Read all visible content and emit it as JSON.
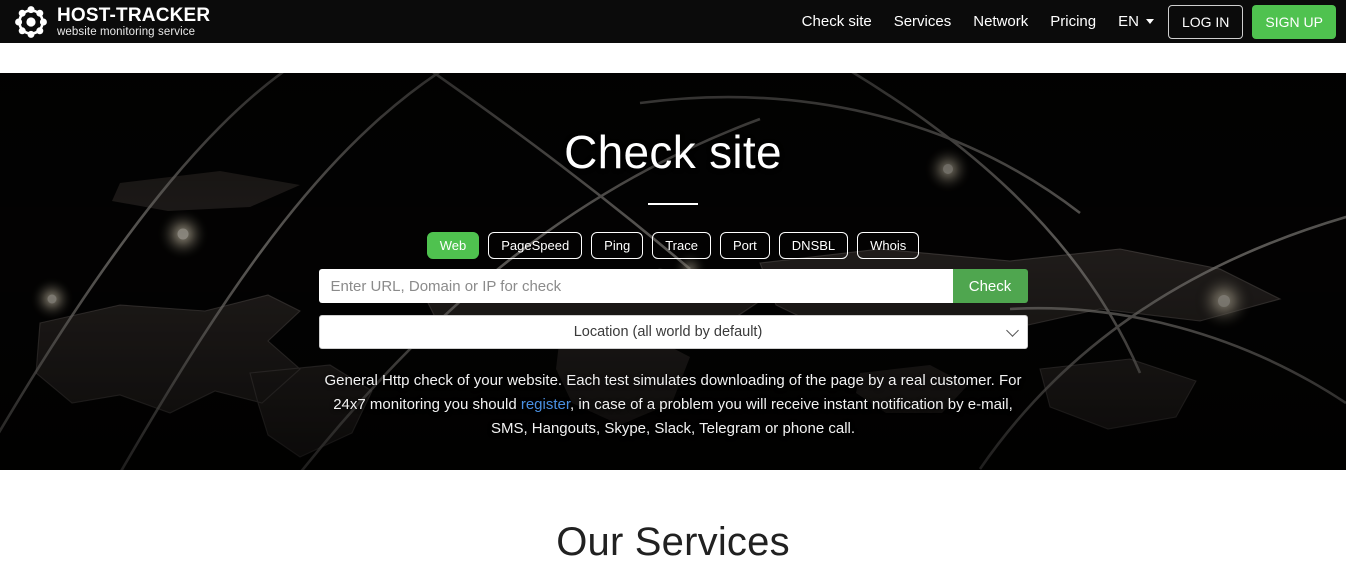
{
  "header": {
    "logo_icon": "atom-ring-icon",
    "brand_name": "HOST-TRACKER",
    "brand_sub": "website monitoring service",
    "nav": [
      {
        "label": "Check site",
        "name": "nav-check-site"
      },
      {
        "label": "Services",
        "name": "nav-services"
      },
      {
        "label": "Network",
        "name": "nav-network"
      },
      {
        "label": "Pricing",
        "name": "nav-pricing"
      }
    ],
    "language": "EN",
    "language_caret_icon": "caret-down-icon",
    "login_label": "LOG IN",
    "signup_label": "SIGN UP"
  },
  "hero": {
    "title": "Check site",
    "tabs": [
      {
        "label": "Web",
        "active": true
      },
      {
        "label": "PageSpeed",
        "active": false
      },
      {
        "label": "Ping",
        "active": false
      },
      {
        "label": "Trace",
        "active": false
      },
      {
        "label": "Port",
        "active": false
      },
      {
        "label": "DNSBL",
        "active": false
      },
      {
        "label": "Whois",
        "active": false
      }
    ],
    "search": {
      "value": "",
      "placeholder": "Enter URL, Domain or IP for check",
      "button_label": "Check"
    },
    "location": {
      "selected": "Location (all world by default)",
      "caret_icon": "chevron-down-icon"
    },
    "description": {
      "part1": "General Http check of your website. Each test simulates downloading of the page by a real customer. For 24x7 monitoring you should ",
      "link": "register",
      "part2": ", in case of a problem you will receive instant notification by e-mail, SMS, Hangouts, Skype, Slack, Telegram or phone call."
    }
  },
  "services": {
    "title": "Our Services"
  },
  "colors": {
    "brand_green": "#4fc24f",
    "check_green": "#4fa64f",
    "header_bg": "#0b0b0b",
    "hero_bg": "#050403",
    "link_blue": "#4a90e2"
  }
}
